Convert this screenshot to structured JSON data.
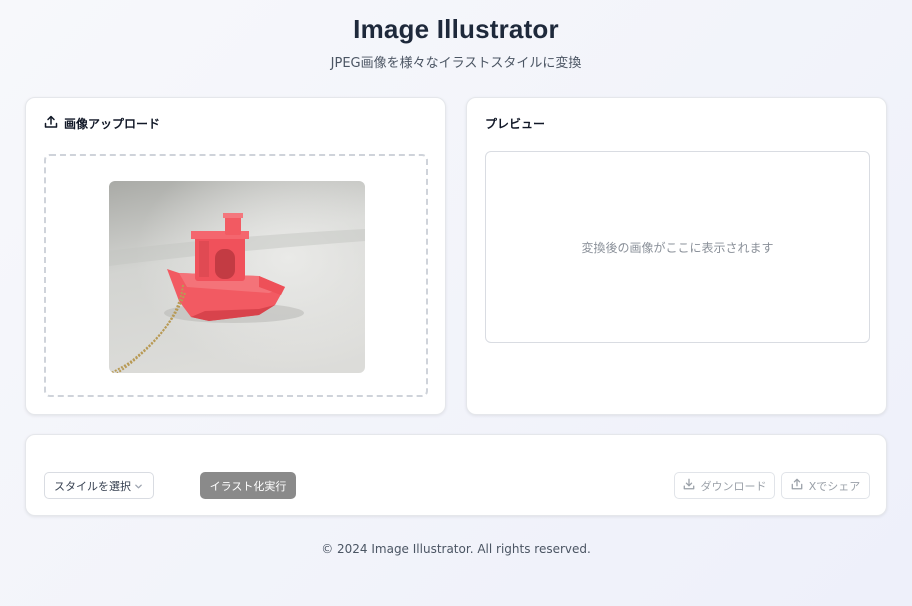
{
  "header": {
    "title": "Image Illustrator",
    "subtitle": "JPEG画像を様々なイラストスタイルに変換"
  },
  "upload": {
    "heading": "画像アップロード",
    "icon": "upload-icon"
  },
  "preview": {
    "heading": "プレビュー",
    "placeholder": "変換後の画像がここに表示されます"
  },
  "actions": {
    "style_select": {
      "value": "スタイルを選択",
      "icon": "chevron-down-icon"
    },
    "run_label": "イラスト化実行",
    "download_label": "ダウンロード",
    "download_icon": "download-icon",
    "share_label": "Xでシェア",
    "share_icon": "share-icon"
  },
  "footer": {
    "copyright": "© 2024 Image Illustrator. All rights reserved."
  },
  "colors": {
    "title": "#1e293b",
    "run_button": "#8a8a8a",
    "boat": "#f25a62"
  }
}
